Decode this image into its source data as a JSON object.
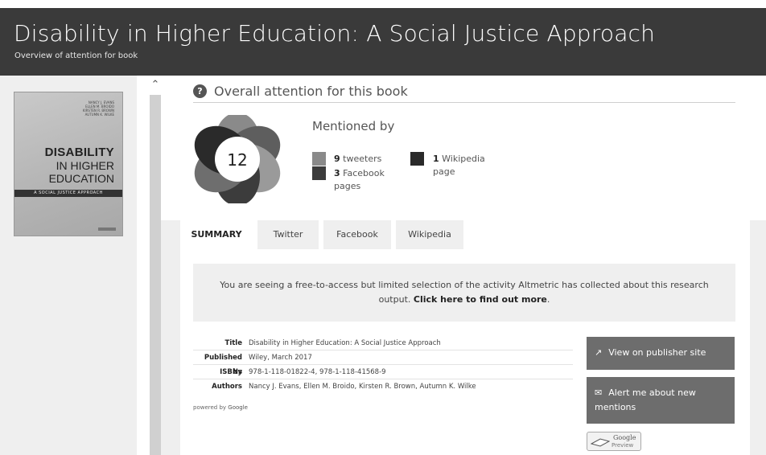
{
  "header": {
    "title": "Disability in Higher Education: A Social Justice Approach",
    "subtitle": "Overview of attention for book"
  },
  "cover": {
    "authors": [
      "NANCY J. EVANS",
      "ELLEN M. BROIDO",
      "KIRSTEN R. BROWN",
      "AUTUMN K. WILKE"
    ],
    "line1": "DISABILITY",
    "line2": "IN HIGHER",
    "line3": "EDUCATION",
    "band": "A SOCIAL JUSTICE APPROACH"
  },
  "overview": {
    "title": "Overall attention for this book",
    "score": "12",
    "mentioned_by": "Mentioned by",
    "legend": [
      {
        "count": "9",
        "label": "tweeters",
        "color": "#8a8a8a"
      },
      {
        "count": "3",
        "label": "Facebook pages",
        "color": "#3c3c3c"
      },
      {
        "count": "1",
        "label": "Wikipedia page",
        "color": "#2a2a2a"
      }
    ]
  },
  "tabs": [
    "SUMMARY",
    "Twitter",
    "Facebook",
    "Wikipedia"
  ],
  "notice": {
    "text": "You are seeing a free-to-access but limited selection of the activity Altmetric has collected about this research output.",
    "link": "Click here to find out more",
    "end": "."
  },
  "meta": [
    {
      "key": "Title",
      "value": "Disability in Higher Education: A Social Justice Approach"
    },
    {
      "key": "Published by",
      "value": "Wiley, March 2017"
    },
    {
      "key": "ISBNs",
      "value": "978-1-118-01822-4, 978-1-118-41568-9"
    },
    {
      "key": "Authors",
      "value": "Nancy J. Evans, Ellen M. Broido, Kirsten R. Brown, Autumn K. Wilke"
    }
  ],
  "powered_by": "powered by",
  "powered_brand": "Google",
  "buttons": {
    "publisher": "View on publisher site",
    "alert": "Alert me about new mentions"
  },
  "google_preview": {
    "line1": "Google",
    "line2": "Preview"
  }
}
